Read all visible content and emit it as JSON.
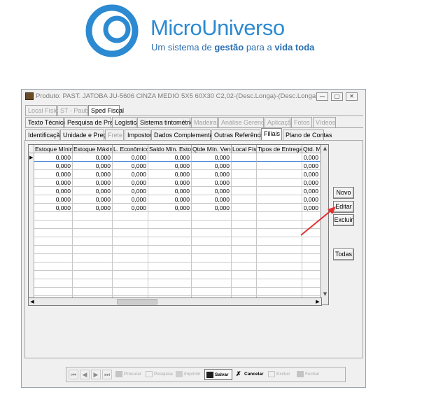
{
  "logo": {
    "name": "MicroUniverso",
    "tagline_parts": [
      "Um sistema de ",
      "gestão",
      " para a ",
      "vida toda"
    ]
  },
  "window": {
    "title": "Produto: PAST. JATOBA JU-5606 CINZA MEDIO 5X5 60X30 C2,02-(Desc.Longa)-(Desc.Longa)"
  },
  "tabs": {
    "row1": [
      "Local Físico",
      "ST - Pauta",
      "Sped Fiscal"
    ],
    "row2": [
      "Texto Técnico",
      "Pesquisa de Preço",
      "Logística",
      "Sistema tintométrico",
      "Madeira",
      "Análise Gerencial",
      "Aplicação",
      "Fotos",
      "Vídeos"
    ],
    "row3": [
      "Identificação",
      "Unidade e Preço",
      "Frete",
      "Impostos",
      "Dados Complementares",
      "Outras Referências",
      "Filiais",
      "Plano de Contas"
    ]
  },
  "grid": {
    "columns": [
      "Estoque Mínimo",
      "Estoque Máximo",
      "L. Econômico",
      "Saldo Mín. Estoque",
      "Qtde Mín. Venda",
      "Local Físico",
      "Tipos de Entrega",
      "Qtd. Mín."
    ],
    "rows": [
      [
        "0,000",
        "0,000",
        "0,000",
        "0,000",
        "0,000",
        "",
        "",
        "0,000"
      ],
      [
        "0,000",
        "0,000",
        "0,000",
        "0,000",
        "0,000",
        "",
        "",
        "0,000"
      ],
      [
        "0,000",
        "0,000",
        "0,000",
        "0,000",
        "0,000",
        "",
        "",
        "0,000"
      ],
      [
        "0,000",
        "0,000",
        "0,000",
        "0,000",
        "0,000",
        "",
        "",
        "0,000"
      ],
      [
        "0,000",
        "0,000",
        "0,000",
        "0,000",
        "0,000",
        "",
        "",
        "0,000"
      ],
      [
        "0,000",
        "0,000",
        "0,000",
        "0,000",
        "0,000",
        "",
        "",
        "0,000"
      ],
      [
        "0,000",
        "0,000",
        "0,000",
        "0,000",
        "0,000",
        "",
        "",
        "0,000"
      ]
    ]
  },
  "side_buttons": {
    "novo": "Novo",
    "editar": "Editar",
    "excluir": "Excluir",
    "todas": "Todas"
  },
  "toolbar": {
    "procurar": "Procurar",
    "pesquisa": "Pesquisa",
    "imprimir": "Imprimir",
    "salvar": "Salvar",
    "cancelar": "Cancelar",
    "excluir": "Excluir",
    "fechar": "Fechar"
  },
  "colors": {
    "logo_blue": "#2b8ad1",
    "arrow_red": "#e53030"
  }
}
